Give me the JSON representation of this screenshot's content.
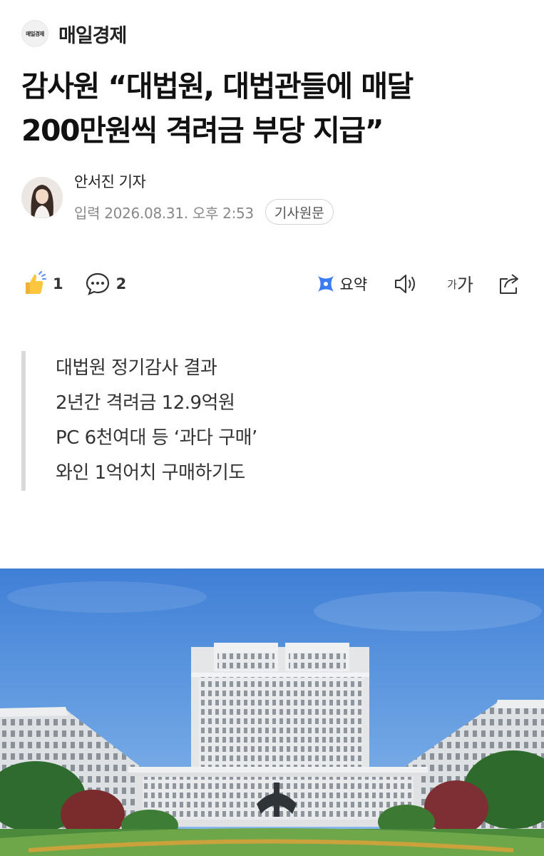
{
  "press": {
    "logo_text": "매일경제",
    "name": "매일경제"
  },
  "headline": {
    "line1": "감사원 “대법원, 대법관들에 매달",
    "line2": "200만원씩 격려금 부당 지급”"
  },
  "byline": {
    "reporter": "안서진 기자",
    "date": "입력 2026.08.31. 오후 2:53",
    "original_button": "기사원문"
  },
  "toolbar": {
    "like_count": "1",
    "comment_count": "2",
    "summary_label": "요약",
    "font_size_small": "가",
    "font_size_large": "가"
  },
  "summary": {
    "lines": [
      "대법원 정기감사 결과",
      "2년간 격려금 12.9억원",
      "PC 6천여대 등 ‘과다 구매’",
      "와인 1억어치 구매하기도"
    ]
  }
}
